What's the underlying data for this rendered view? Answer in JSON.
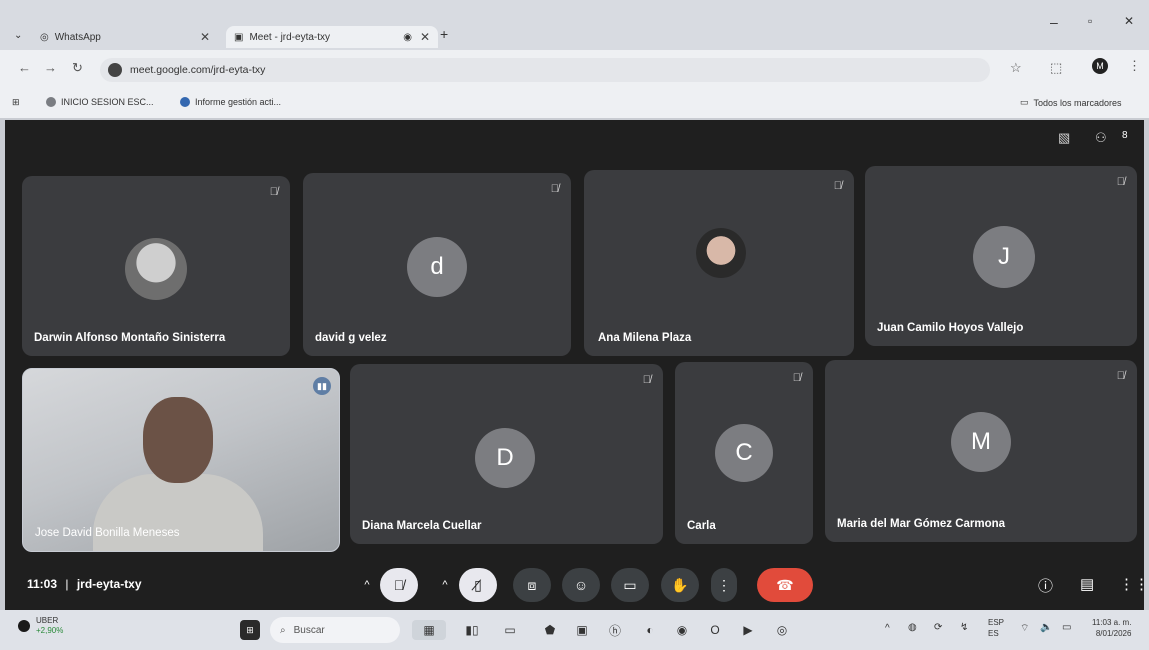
{
  "browser": {
    "tabs": [
      {
        "label": "WhatsApp",
        "active": false
      },
      {
        "label": "Meet - jrd-eyta-txy",
        "active": true
      }
    ],
    "url": "meet.google.com/jrd-eyta-txy",
    "bookmarks": [
      "INICIO SESION ESC...",
      "Informe gestión acti..."
    ],
    "all_bookmarks": "Todos los marcadores",
    "profile_initial": "M"
  },
  "meet": {
    "participants": [
      {
        "name": "Darwin Alfonso Montaño Sinisterra",
        "avatar": "photo"
      },
      {
        "name": "david g velez",
        "avatar": "d"
      },
      {
        "name": "Ana Milena Plaza",
        "avatar": "photo"
      },
      {
        "name": "Juan Camilo Hoyos Vallejo",
        "avatar": "J"
      },
      {
        "name": "Jose David Bonilla Meneses",
        "avatar": "video"
      },
      {
        "name": "Diana Marcela Cuellar",
        "avatar": "D"
      },
      {
        "name": "Carla",
        "avatar": "C"
      },
      {
        "name": "Maria del Mar Gómez Carmona",
        "avatar": "M"
      }
    ],
    "time": "11:03",
    "meeting_code": "jrd-eyta-txy",
    "participant_count": "8"
  },
  "taskbar": {
    "weather_title": "UBER",
    "weather_value": "+2,90%",
    "search_placeholder": "Buscar",
    "lang_top": "ESP",
    "lang_bottom": "ES",
    "clock_time": "11:03 a. m.",
    "clock_date": "8/01/2026"
  },
  "colors": {
    "meet_bg": "#1f1f1f",
    "tile": "#3b3c3f",
    "end_call": "#e14b3b",
    "active_ctl": "#e8e8ee"
  }
}
